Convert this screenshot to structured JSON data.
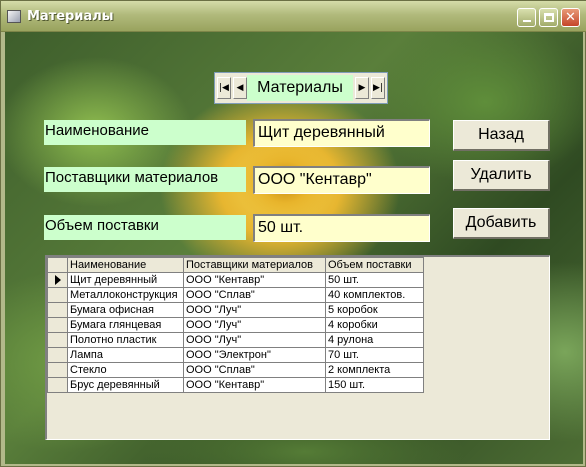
{
  "window": {
    "title": "Материалы"
  },
  "navigator": {
    "caption": "Материалы",
    "first_icon": "first-record-icon",
    "prev_icon": "prev-record-icon",
    "next_icon": "next-record-icon",
    "last_icon": "last-record-icon"
  },
  "form": {
    "name_label": "Наименование",
    "name_value": "Щит деревянный",
    "supplier_label": "Поставщики материалов",
    "supplier_value": "ООО \"Кентавр\"",
    "volume_label": "Объем поставки",
    "volume_value": "50 шт."
  },
  "buttons": {
    "back": "Назад",
    "delete": "Удалить",
    "add": "Добавить"
  },
  "grid": {
    "columns": [
      "Наименование",
      "Поставщики материалов",
      "Объем поставки"
    ],
    "current_row": 0,
    "rows": [
      [
        "Щит деревянный",
        "ООО \"Кентавр\"",
        "50 шт."
      ],
      [
        "Металлоконструкция",
        "ООО \"Сплав\"",
        "40 комплектов."
      ],
      [
        "Бумага офисная",
        "ООО \"Луч\"",
        "5 коробок"
      ],
      [
        "Бумага глянцевая",
        "ООО \"Луч\"",
        "4 коробки"
      ],
      [
        "Полотно пластик",
        "ООО \"Луч\"",
        "4 рулона"
      ],
      [
        "Лампа",
        "ООО \"Электрон\"",
        "70 шт."
      ],
      [
        "Стекло",
        "ООО \"Сплав\"",
        "2 комплекта"
      ],
      [
        "Брус деревянный",
        "ООО \"Кентавр\"",
        "150 шт."
      ]
    ]
  },
  "colors": {
    "label_bg": "#ccffcc",
    "field_bg": "#ffffcc",
    "titlebar": "#b1ba7c"
  }
}
